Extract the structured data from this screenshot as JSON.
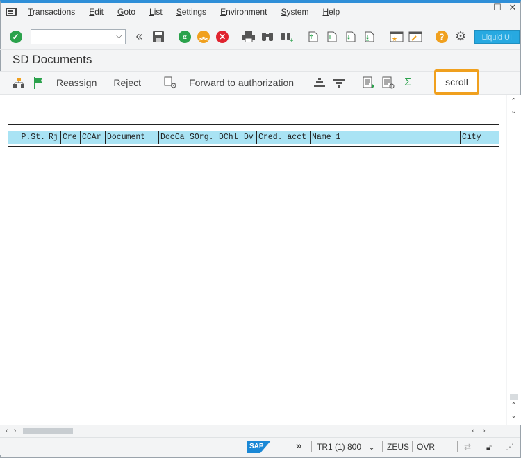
{
  "menu": [
    "Transactions",
    "Edit",
    "Goto",
    "List",
    "Settings",
    "Environment",
    "System",
    "Help"
  ],
  "toolbar": {
    "liquid_label": "Liquid UI"
  },
  "title": "SD Documents",
  "app_toolbar": {
    "reassign": "Reassign",
    "reject": "Reject",
    "forward": "Forward to authorization",
    "scroll": "scroll",
    "sum": "Σ"
  },
  "grid": {
    "columns": [
      "P.St.",
      "Rj",
      "Cre",
      "CCAr",
      "Document",
      "DocCa",
      "SOrg.",
      "DChl",
      "Dv",
      "Cred. acct",
      "Name 1",
      "City"
    ]
  },
  "status": {
    "system": "TR1 (1) 800",
    "server": "ZEUS",
    "mode": "OVR",
    "logo": "SAP"
  },
  "colors": {
    "accent": "#2f8fd8",
    "highlight": "#f0a01e",
    "row": "#a9e3f4"
  }
}
